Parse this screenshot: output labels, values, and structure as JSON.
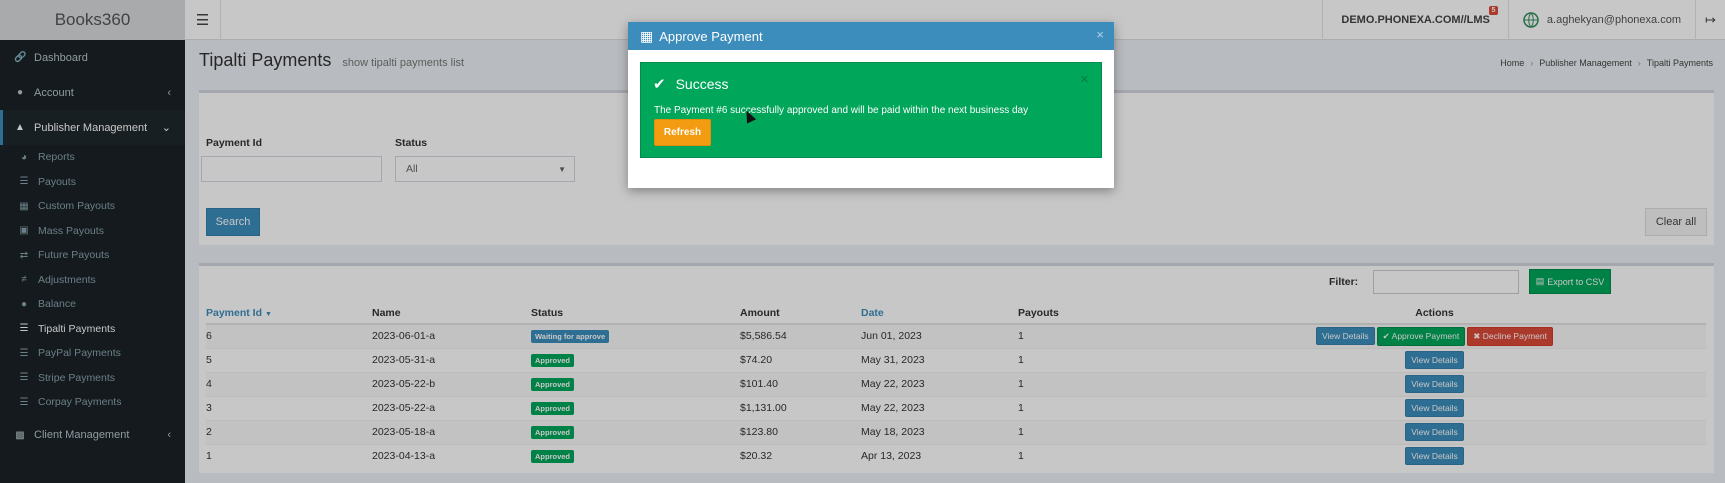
{
  "app": {
    "name": "Books360"
  },
  "header": {
    "menu_icon": "bars-icon",
    "domain": "DEMO.PHONEXA.COM//LMS",
    "domain_badge": "5",
    "user_email": "a.aghekyan@phonexa.com",
    "logout_icon": "sign-out-icon"
  },
  "sidebar": {
    "items": [
      {
        "label": "Dashboard",
        "icon": "link-icon"
      },
      {
        "label": "Account",
        "icon": "users-icon"
      },
      {
        "label": "Publisher Management",
        "icon": "cubes-icon"
      }
    ],
    "sub_items": [
      {
        "label": "Reports"
      },
      {
        "label": "Payouts"
      },
      {
        "label": "Custom Payouts"
      },
      {
        "label": "Mass Payouts"
      },
      {
        "label": "Future Payouts"
      },
      {
        "label": "Adjustments"
      },
      {
        "label": "Balance"
      },
      {
        "label": "Tipalti Payments"
      },
      {
        "label": "PayPal Payments"
      },
      {
        "label": "Stripe Payments"
      },
      {
        "label": "Corpay Payments"
      }
    ],
    "client_management": "Client Management"
  },
  "page": {
    "title": "Tipalti Payments",
    "subtitle": "show tipalti payments list",
    "breadcrumb": [
      "Home",
      "Publisher Management",
      "Tipalti Payments"
    ]
  },
  "filters": {
    "payment_id_label": "Payment Id",
    "payment_id_value": "",
    "status_label": "Status",
    "status_value": "All",
    "search_label": "Search",
    "clear_label": "Clear all"
  },
  "table": {
    "filter_label": "Filter:",
    "export_label": "Export to CSV",
    "columns": [
      "Payment Id",
      "Name",
      "Status",
      "Amount",
      "Date",
      "Payouts",
      "Actions"
    ],
    "rows": [
      {
        "id": "6",
        "name": "2023-06-01-a",
        "status": "Waiting for approve",
        "amount": "$5,586.54",
        "date": "Jun 01, 2023",
        "payouts": "1"
      },
      {
        "id": "5",
        "name": "2023-05-31-a",
        "status": "Approved",
        "amount": "$74.20",
        "date": "May 31, 2023",
        "payouts": "1"
      },
      {
        "id": "4",
        "name": "2023-05-22-b",
        "status": "Approved",
        "amount": "$101.40",
        "date": "May 22, 2023",
        "payouts": "1"
      },
      {
        "id": "3",
        "name": "2023-05-22-a",
        "status": "Approved",
        "amount": "$1,131.00",
        "date": "May 22, 2023",
        "payouts": "1"
      },
      {
        "id": "2",
        "name": "2023-05-18-a",
        "status": "Approved",
        "amount": "$123.80",
        "date": "May 18, 2023",
        "payouts": "1"
      },
      {
        "id": "1",
        "name": "2023-04-13-a",
        "status": "Approved",
        "amount": "$20.32",
        "date": "Apr 13, 2023",
        "payouts": "1"
      }
    ],
    "view_details": "View Details",
    "approve_payment": "Approve Payment",
    "decline_payment": "Decline Payment"
  },
  "modal": {
    "title": "Approve Payment",
    "close": "×",
    "alert_title": "Success",
    "alert_message": "The Payment #6 successfully approved and will be paid within the next business day",
    "refresh_label": "Refresh"
  },
  "colors": {
    "primary": "#3c8dbc",
    "success": "#00a65a",
    "danger": "#dd4b39",
    "warning": "#f39c12",
    "sidebar": "#1a2226"
  }
}
